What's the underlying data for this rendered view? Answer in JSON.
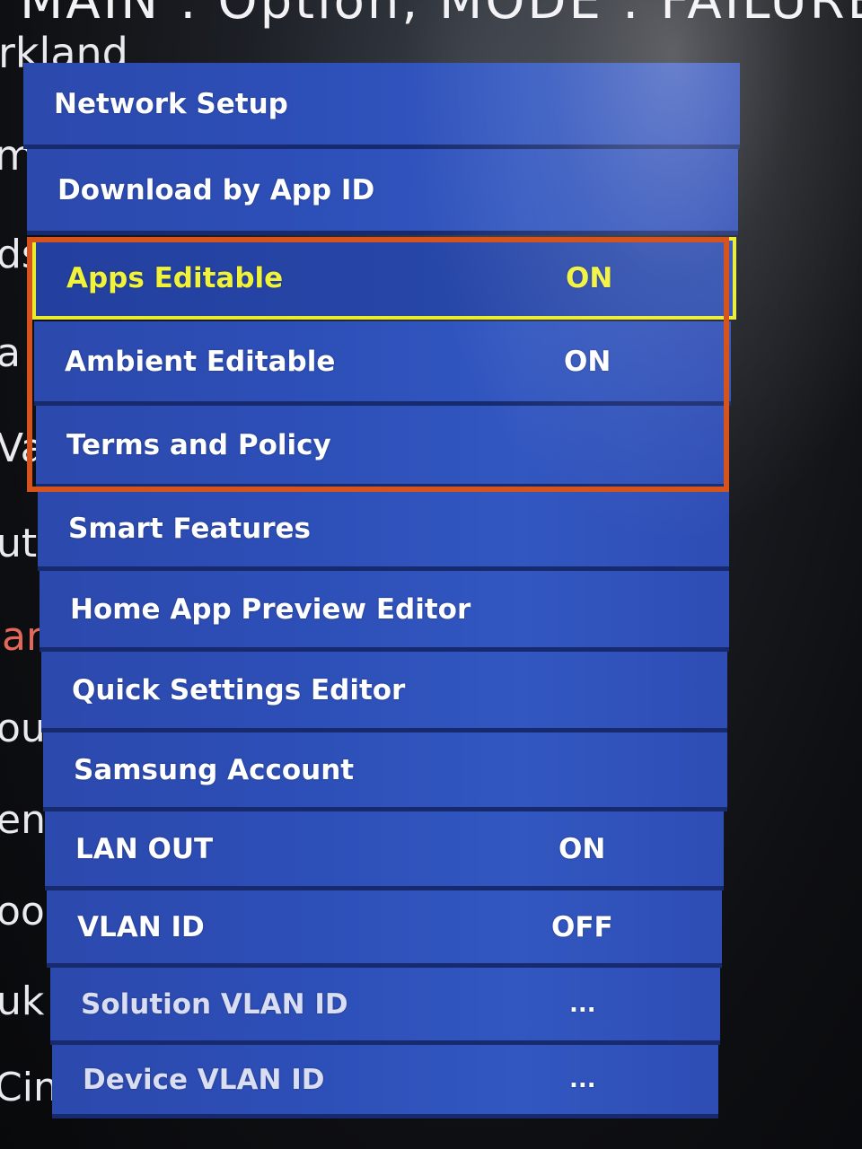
{
  "background": {
    "header": "MAIN : Option, MODE : FAILURE",
    "lines": [
      "rkland",
      "me zone",
      "ds",
      "a",
      "Va",
      "ut",
      "ar",
      "ounting",
      "entral Park",
      "oo",
      "uk",
      "Cine"
    ]
  },
  "menu": {
    "items": [
      {
        "label": "Network Setup",
        "value": ""
      },
      {
        "label": "Download by App ID",
        "value": ""
      },
      {
        "label": "Apps Editable",
        "value": "ON"
      },
      {
        "label": "Ambient Editable",
        "value": "ON"
      },
      {
        "label": "Terms and Policy",
        "value": ""
      },
      {
        "label": "Smart Features",
        "value": ""
      },
      {
        "label": "Home App Preview Editor",
        "value": ""
      },
      {
        "label": "Quick Settings Editor",
        "value": ""
      },
      {
        "label": "Samsung Account",
        "value": ""
      },
      {
        "label": "LAN OUT",
        "value": "ON"
      },
      {
        "label": "VLAN ID",
        "value": "OFF"
      },
      {
        "label": "Solution VLAN ID",
        "value": "..."
      },
      {
        "label": "Device VLAN ID",
        "value": "..."
      }
    ],
    "focused_index": 2
  },
  "colors": {
    "menu_blue": "#2d4fb8",
    "focus_yellow": "#f1f23a",
    "annotation_orange": "#d5541d",
    "background_red_text": "#e4685a"
  }
}
